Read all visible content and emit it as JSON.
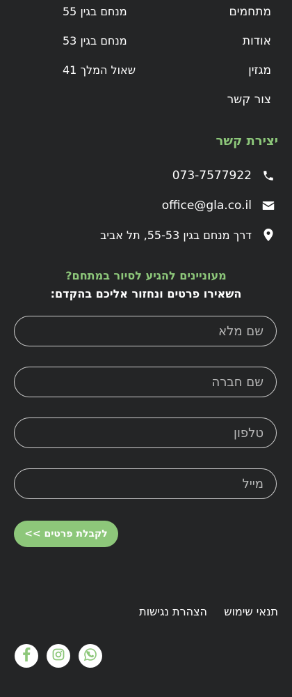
{
  "nav": {
    "items": [
      {
        "label": "מתחמים"
      },
      {
        "label": "אודות"
      },
      {
        "label": "מגזין"
      },
      {
        "label": "צור קשר"
      }
    ]
  },
  "addresses": [
    {
      "text": "מנחם בגין 55"
    },
    {
      "text": "מנחם בגין 53"
    },
    {
      "text": "שאול המלך 41"
    }
  ],
  "contact": {
    "title": "יצירת קשר",
    "phone": "073-7577922",
    "email": "office@gla.co.il",
    "address": "דרך מנחם בגין 55-53, תל אביב"
  },
  "form": {
    "headline": "מעוניינים להגיע לסיור במתחם?",
    "subheadline": "השאירו פרטים ונחזור אליכם בהקדם:",
    "fields": {
      "full_name": {
        "placeholder": "שם מלא",
        "value": ""
      },
      "company": {
        "placeholder": "שם חברה",
        "value": ""
      },
      "phone": {
        "placeholder": "טלפון",
        "value": ""
      },
      "email": {
        "placeholder": "מייל",
        "value": ""
      }
    },
    "submit_label": "לקבלת פרטים >>"
  },
  "footer": {
    "terms": "תנאי שימוש",
    "accessibility": "הצהרת נגישות",
    "social": [
      {
        "icon": "whatsapp-icon"
      },
      {
        "icon": "instagram-icon"
      },
      {
        "icon": "facebook-icon"
      }
    ]
  },
  "colors": {
    "background": "#242526",
    "accent": "#8dc77a",
    "text": "#ffffff"
  }
}
